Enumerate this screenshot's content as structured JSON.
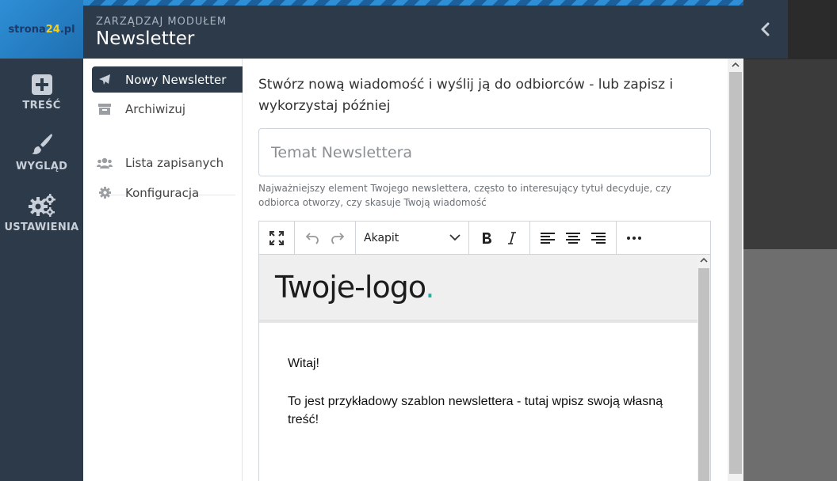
{
  "brand": {
    "logo_prefix": "strona",
    "logo_number": "24",
    "logo_suffix": ".pl"
  },
  "sidebar": {
    "items": [
      {
        "label": "TREŚĆ",
        "icon": "plus-square-icon"
      },
      {
        "label": "WYGLĄD",
        "icon": "paintbrush-icon"
      },
      {
        "label": "USTAWIENIA",
        "icon": "gears-icon"
      }
    ]
  },
  "header": {
    "subtitle": "ZARZĄDZAJ MODUŁEM",
    "title": "Newsletter"
  },
  "menu": {
    "items": [
      {
        "label": "Nowy Newsletter",
        "icon": "paper-plane-icon",
        "active": true
      },
      {
        "label": "Archiwizuj",
        "icon": "archive-icon"
      },
      {
        "label": "Lista zapisanych",
        "icon": "users-icon"
      },
      {
        "label": "Konfiguracja",
        "icon": "gear-icon"
      }
    ]
  },
  "main": {
    "intro": "Stwórz nową wiadomość i wyślij ją do odbiorców - lub zapisz i wykorzystaj później",
    "subject_placeholder": "Temat Newslettera",
    "subject_value": "",
    "hint": "Najważniejszy element Twojego newslettera, często to interesujący tytuł decyduje, czy odbiorca otworzy, czy skasuje Twoją wiadomość"
  },
  "editor": {
    "format_value": "Akapit",
    "toolbar_icons": [
      "fullscreen-icon",
      "undo-icon",
      "redo-icon",
      "bold-icon",
      "italic-icon",
      "align-left-icon",
      "align-center-icon",
      "align-right-icon",
      "more-icon"
    ],
    "logo_text": "Twoje-logo",
    "logo_dot": ".",
    "greeting": "Witaj!",
    "body": "To jest przykładowy szablon newslettera - tutaj wpisz swoją własną treść!"
  },
  "colors": {
    "sidebar_bg": "#2c3a4a",
    "accent_blue": "#2e8fd6",
    "logo_dot": "#19b3a8"
  }
}
